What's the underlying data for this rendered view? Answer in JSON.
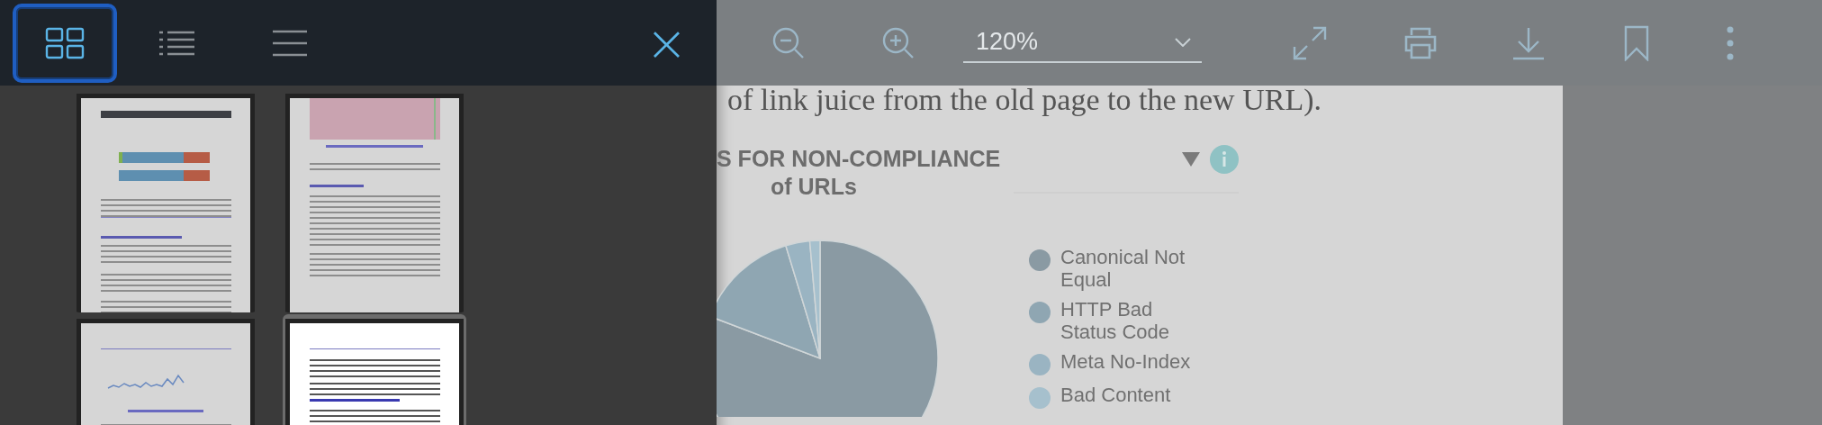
{
  "sidebar": {
    "view_buttons": [
      {
        "kind": "grid",
        "selected": true
      },
      {
        "kind": "outline",
        "selected": false
      },
      {
        "kind": "lines",
        "selected": false
      }
    ],
    "close": "×",
    "thumbnails": [
      {
        "kind": "chart",
        "selected": false
      },
      {
        "kind": "table",
        "selected": false
      },
      {
        "kind": "graph",
        "selected": false
      },
      {
        "kind": "text",
        "selected": true
      }
    ]
  },
  "toolbar": {
    "zoom_level": "120%",
    "buttons": [
      {
        "kind": "zoom-out"
      },
      {
        "kind": "zoom-in"
      },
      {
        "kind": "fullscreen"
      },
      {
        "kind": "print"
      },
      {
        "kind": "download"
      },
      {
        "kind": "bookmark"
      },
      {
        "kind": "more"
      }
    ]
  },
  "document": {
    "text_line": "of link juice from the old page to the new URL).",
    "chart_title_lines": [
      "S FOR NON-COMPLIANCE",
      "of URLs"
    ],
    "legend": [
      {
        "label": "Canonical Not Equal",
        "color": "#8a9aa3"
      },
      {
        "label": "HTTP Bad Status Code",
        "color": "#8fa6b2"
      },
      {
        "label": "Meta No-Index",
        "color": "#9ab4c2"
      },
      {
        "label": "Bad Content",
        "color": "#a6c0cd"
      }
    ]
  }
}
